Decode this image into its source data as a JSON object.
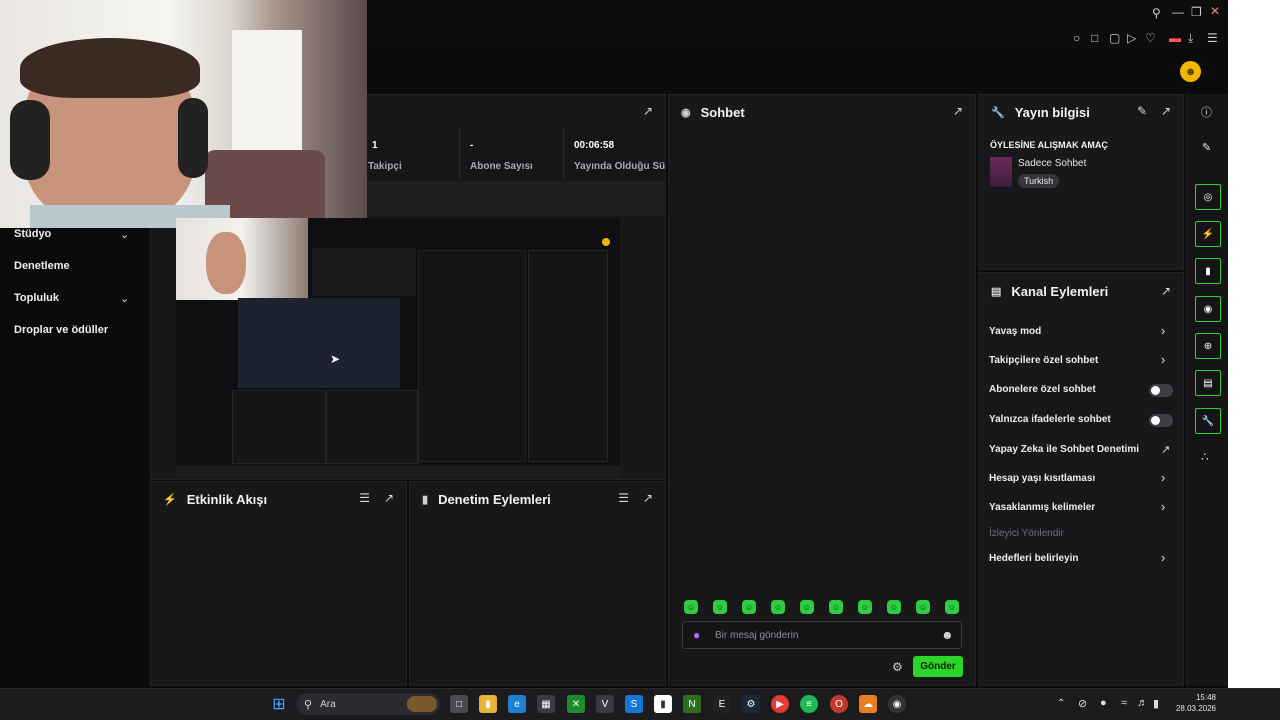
{
  "stats": [
    {
      "value": "1",
      "label": "Takipçi"
    },
    {
      "value": "-",
      "label": "Abone Sayısı"
    },
    {
      "value": "00:06:58",
      "label": "Yayında Olduğu Süre"
    }
  ],
  "nav": {
    "items": [
      {
        "label": "Stüdyo",
        "has_chevron": true
      },
      {
        "label": "Denetleme",
        "has_chevron": false
      },
      {
        "label": "Topluluk",
        "has_chevron": true
      },
      {
        "label": "Droplar ve ödüller",
        "has_chevron": false
      }
    ]
  },
  "panels": {
    "chat_title": "Sohbet",
    "stream_info_title": "Yayın bilgisi",
    "channel_actions_title": "Kanal Eylemleri",
    "activity_feed_title": "Etkinlik Akışı",
    "mod_actions_title": "Denetim Eylemleri"
  },
  "stream_info": {
    "title": "ÖYLESİNE ALIŞMAK AMAÇ",
    "category": "Sadece Sohbet",
    "tag": "Turkish"
  },
  "channel_actions": [
    {
      "label": "Yavaş mod",
      "control": "chevron"
    },
    {
      "label": "Takipçilere özel sohbet",
      "control": "chevron"
    },
    {
      "label": "Abonelere özel sohbet",
      "control": "toggle",
      "on": false
    },
    {
      "label": "Yalnızca ifadelerle sohbet",
      "control": "toggle",
      "on": false
    },
    {
      "label": "Yapay Zeka ile Sohbet Denetimi",
      "control": "external"
    },
    {
      "label": "Hesap yaşı kısıtlaması",
      "control": "chevron"
    },
    {
      "label": "Yasaklanmış kelimeler",
      "control": "chevron"
    },
    {
      "label": "İzleyici Yönlendir",
      "control": "none",
      "disabled": true
    },
    {
      "label": "Hedefleri belirleyin",
      "control": "chevron"
    }
  ],
  "chat": {
    "placeholder": "Bir mesaj gönderin",
    "send_label": "Gönder"
  },
  "taskbar": {
    "search_label": "Ara",
    "time": "15:48",
    "date": "28.03.2026"
  },
  "colors": {
    "accent": "#2bd62b",
    "panel_bg": "#18181b",
    "page_bg": "#0b0b0c"
  }
}
